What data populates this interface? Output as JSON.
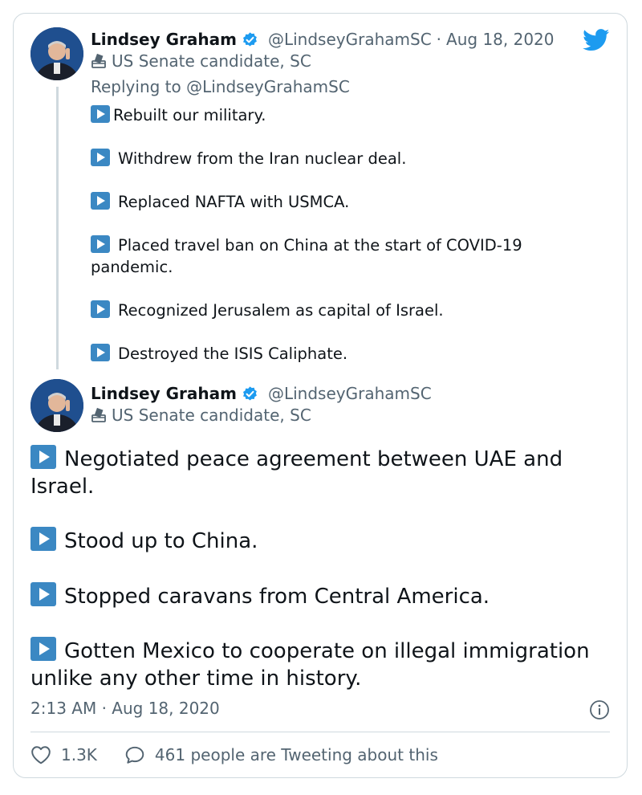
{
  "reply_tweet": {
    "author_name": "Lindsey Graham",
    "handle": "@LindseyGrahamSC",
    "separator": "·",
    "date": "Aug 18, 2020",
    "label": "US Senate candidate, SC",
    "replying_to": "Replying to @LindseyGrahamSC",
    "items": [
      "Rebuilt our military.",
      "Withdrew from the Iran nuclear deal.",
      "Replaced NAFTA with USMCA.",
      "Placed travel ban on China at the start of COVID-19 pandemic.",
      "Recognized Jerusalem as capital of Israel.",
      "Destroyed the ISIS Caliphate."
    ]
  },
  "main_tweet": {
    "author_name": "Lindsey Graham",
    "handle": "@LindseyGrahamSC",
    "label": "US Senate candidate, SC",
    "items": [
      "Negotiated peace agreement between UAE and Israel.",
      "Stood up to China.",
      "Stopped caravans from Central America.",
      "Gotten Mexico to cooperate on illegal immigration unlike any other time in history."
    ],
    "timestamp": "2:13 AM · Aug 18, 2020",
    "like_count": "1.3K",
    "tweeting_text": "461 people are Tweeting about this"
  },
  "icons": {
    "brand": "twitter-bird-icon",
    "verified": "verified-badge-icon",
    "label": "ballot-box-icon",
    "bullet": "play-button-emoji-icon",
    "info": "info-icon",
    "like": "heart-icon",
    "reply": "speech-bubble-icon"
  },
  "colors": {
    "twitter_blue": "#1d9bf0",
    "secondary_text": "#536471",
    "emoji_blue": "#3b88c3",
    "border": "#cfd9de"
  }
}
